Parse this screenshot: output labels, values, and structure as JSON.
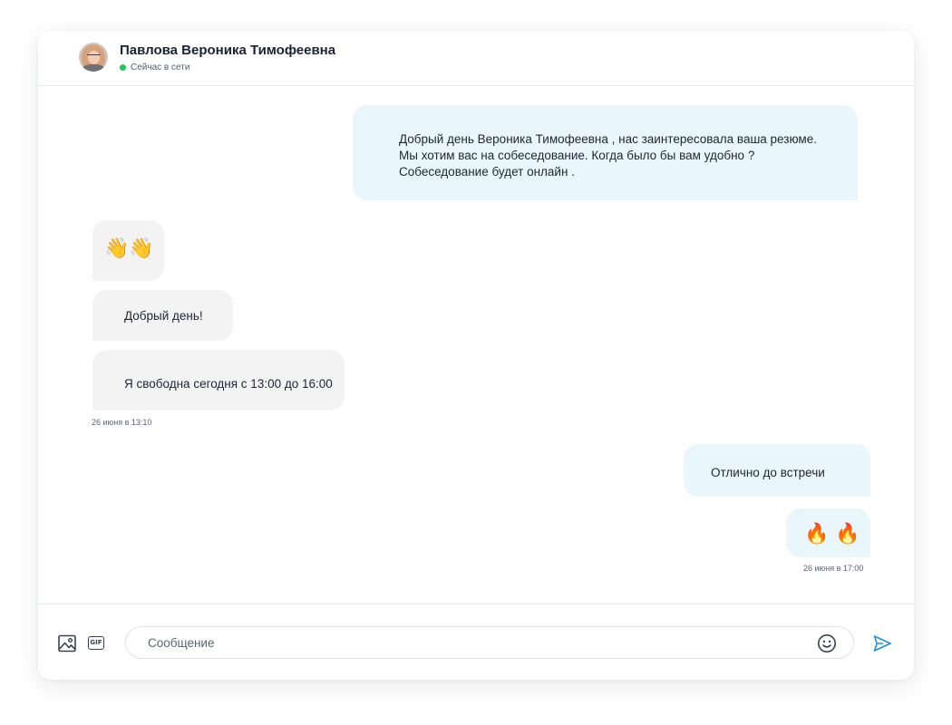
{
  "header": {
    "contact_name": "Павлова Вероника Тимофеевна",
    "status": "Сейчас в сети",
    "status_color": "#22c55e"
  },
  "messages": [
    {
      "direction": "outgoing",
      "lines": [
        "Добрый день Вероника Тимофеевна , нас заинтересовала ваша резюме.",
        "Мы хотим вас на собеседование. Когда было бы вам удобно ?",
        "Собеседование будет онлайн ."
      ]
    },
    {
      "direction": "incoming",
      "emoji": "👋👋"
    },
    {
      "direction": "incoming",
      "text": "Добрый день!"
    },
    {
      "direction": "incoming",
      "text": "Я свободна сегодня с 13:00 до 16:00"
    },
    {
      "direction": "outgoing",
      "text": "Отлично до встречи"
    },
    {
      "direction": "outgoing",
      "emoji": "🔥 🔥"
    }
  ],
  "timestamps": {
    "incoming_group": "26 июня в  13:10",
    "outgoing_group": "26 июня в  17:00"
  },
  "composer": {
    "placeholder": "Сообщение",
    "value": "",
    "image_icon": "image-icon",
    "gif_label": "GIF",
    "emoji_icon": "smile-icon",
    "send_icon": "send-icon"
  },
  "colors": {
    "outgoing_bubble": "#e9f6fc",
    "incoming_bubble": "#f3f3f4",
    "accent": "#1c8fe6"
  }
}
